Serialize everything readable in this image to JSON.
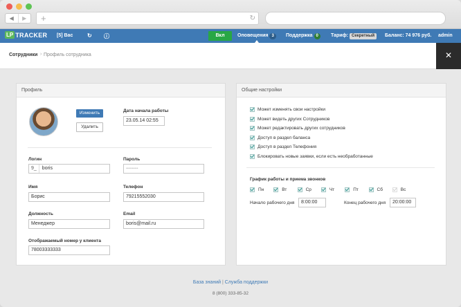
{
  "header": {
    "logo_lp": "LP",
    "logo_tracker": "TRACKER",
    "user_short": "[5] Вас",
    "toggle_label": "Вкл",
    "notifications_label": "Оповещения",
    "notifications_count": "3",
    "support_label": "Поддержка",
    "support_count": "0",
    "tariff_label": "Тариф:",
    "tariff_value": "Секретный",
    "balance": "Баланс: 74 976 руб.",
    "user": "admin"
  },
  "breadcrumb": {
    "parent": "Сотрудники",
    "separator": "›",
    "current": "Профиль сотрудника"
  },
  "profile": {
    "title": "Профиль",
    "change_button": "Изменить",
    "delete_button": "Удалить",
    "start_date_label": "Дата начала работы",
    "start_date_value": "23.05.14 02:55",
    "login_label": "Логин",
    "login_prefix": "9_",
    "login_value": "boris",
    "password_label": "Пароль",
    "password_value": "••••••••••",
    "name_label": "Имя",
    "name_value": "Борис",
    "phone_label": "Телефон",
    "phone_value": "79215552030",
    "position_label": "Должность",
    "position_value": "Менеджер",
    "email_label": "Email",
    "email_value": "boris@mail.ru",
    "display_number_label": "Отображаемый номер у клиента",
    "display_number_value": "78003333333"
  },
  "settings": {
    "title": "Общие настройки",
    "permissions": [
      "Может изменять свои настройки",
      "Может видеть других Сотрудников",
      "Может редактировать других сотрудников",
      "Доступ в раздел баланса",
      "Доступ в раздел Телефония",
      "Блокировать новые заявки, если есть необработанные"
    ],
    "schedule_label": "График работы и приема звонков",
    "days": [
      {
        "label": "Пн",
        "checked": true
      },
      {
        "label": "Вт",
        "checked": true
      },
      {
        "label": "Ср",
        "checked": true
      },
      {
        "label": "Чт",
        "checked": true
      },
      {
        "label": "Пт",
        "checked": true
      },
      {
        "label": "Сб",
        "checked": true
      },
      {
        "label": "Вс",
        "checked": false
      }
    ],
    "start_label": "Начало рабочего дня",
    "start_value": "8:00:00",
    "end_label": "Конец рабочего дня",
    "end_value": "20:00:00"
  },
  "footer": {
    "kb_link": "База знаний",
    "divider": "|",
    "support_link": "Служба поддержки",
    "phone": "8 (800) 333-85-32"
  },
  "colors": {
    "header_blue": "#3f7ab5",
    "green": "#28a745",
    "check_teal": "#2b8f8a"
  }
}
